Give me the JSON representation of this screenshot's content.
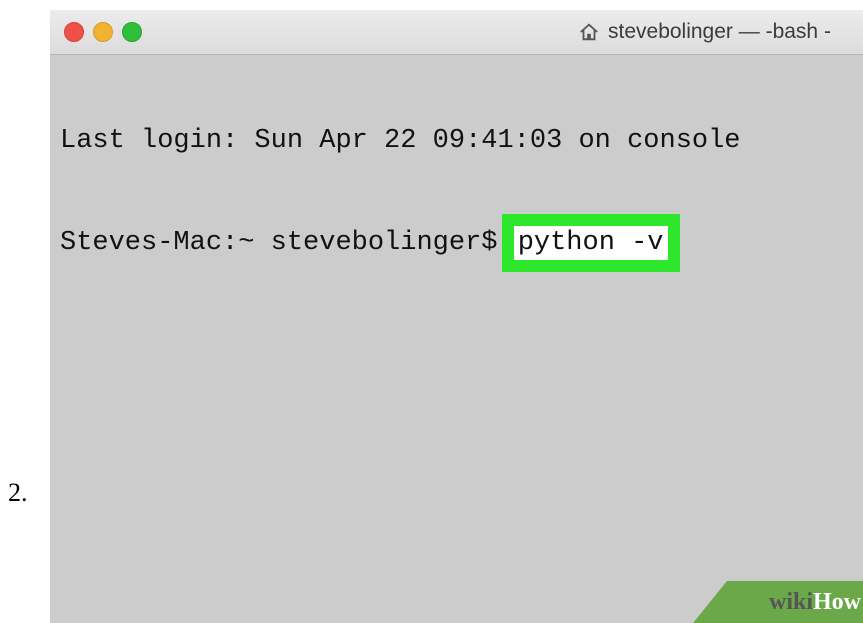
{
  "step_number": "2.",
  "window": {
    "title": "stevebolinger — -bash -",
    "title_icon": "home-icon",
    "traffic_lights": [
      "close",
      "minimize",
      "zoom"
    ],
    "colors": {
      "close": "#f0504a",
      "minimize": "#f2b231",
      "zoom": "#2fbf3b",
      "background": "#cccccc"
    }
  },
  "terminal": {
    "login_line": "Last login: Sun Apr 22 09:41:03 on console",
    "prompt": "Steves-Mac:~ stevebolinger$ ",
    "command": "python -v",
    "highlight_color": "#2ee62b"
  },
  "watermark": {
    "part1": "wiki",
    "part2": "How"
  }
}
